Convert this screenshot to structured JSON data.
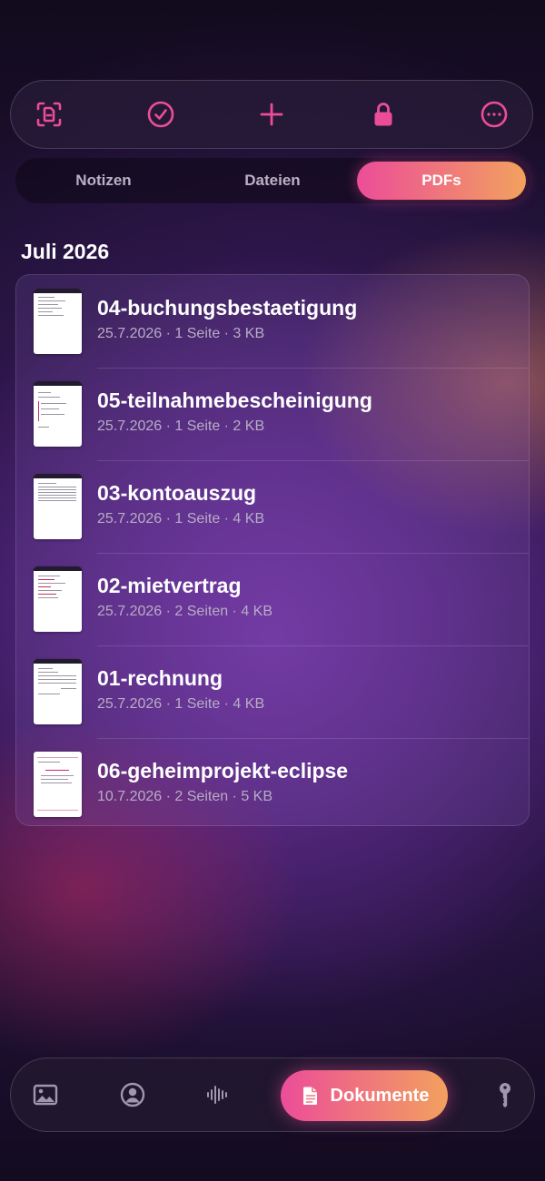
{
  "toolbar": {
    "buttons": [
      {
        "name": "scan-document-icon"
      },
      {
        "name": "checkmark-circle-icon"
      },
      {
        "name": "plus-icon"
      },
      {
        "name": "lock-icon"
      },
      {
        "name": "more-circle-icon"
      }
    ],
    "accent_color": "#ec4d98"
  },
  "tabs": [
    {
      "label": "Notizen",
      "active": false
    },
    {
      "label": "Dateien",
      "active": false
    },
    {
      "label": "PDFs",
      "active": true
    }
  ],
  "section_title": "Juli 2026",
  "documents": [
    {
      "name": "04-buchungsbestaetigung",
      "info": "25.7.2026 · 1 Seite · 3 KB"
    },
    {
      "name": "05-teilnahmebescheinigung",
      "info": "25.7.2026 · 1 Seite · 2 KB"
    },
    {
      "name": "03-kontoauszug",
      "info": "25.7.2026 · 1 Seite · 4 KB"
    },
    {
      "name": "02-mietvertrag",
      "info": "25.7.2026 · 2 Seiten · 4 KB"
    },
    {
      "name": "01-rechnung",
      "info": "25.7.2026 · 1 Seite · 4 KB"
    },
    {
      "name": "06-geheimprojekt-eclipse",
      "info": "10.7.2026 · 2 Seiten · 5 KB"
    }
  ],
  "bottom_nav": {
    "items": [
      {
        "name": "photos-icon"
      },
      {
        "name": "contact-icon"
      },
      {
        "name": "audio-waveform-icon"
      },
      {
        "name": "document-icon",
        "label": "Dokumente",
        "active": true
      },
      {
        "name": "key-icon"
      }
    ],
    "gradient": [
      "#ec4d98",
      "#f2a15e"
    ]
  }
}
